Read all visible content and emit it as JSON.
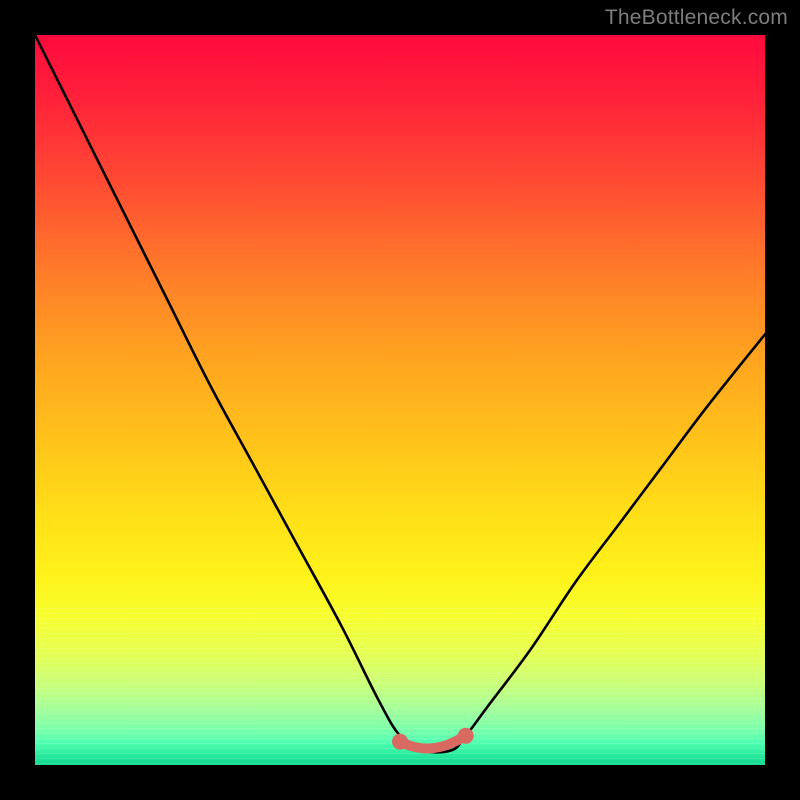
{
  "attribution": "TheBottleneck.com",
  "colors": {
    "frame": "#000000",
    "curve": "#000000",
    "flat_segment": "#d86a62"
  },
  "chart_data": {
    "type": "line",
    "title": "",
    "xlabel": "",
    "ylabel": "",
    "xlim": [
      0,
      100
    ],
    "ylim": [
      0,
      100
    ],
    "series": [
      {
        "name": "bottleneck-curve",
        "x": [
          0,
          6,
          12,
          18,
          24,
          30,
          36,
          42,
          47,
          50,
          53,
          57,
          59,
          62,
          68,
          74,
          80,
          86,
          92,
          100
        ],
        "y": [
          100,
          88,
          76,
          64,
          52,
          41,
          30,
          19,
          9,
          4,
          2,
          2,
          4,
          8,
          16,
          25,
          33,
          41,
          49,
          59
        ]
      },
      {
        "name": "optimal-flat-segment",
        "x": [
          50,
          51.5,
          53,
          54.5,
          56,
          57.5,
          59
        ],
        "y": [
          3.2,
          2.6,
          2.3,
          2.3,
          2.6,
          3.2,
          4.0
        ]
      }
    ],
    "annotations": []
  }
}
